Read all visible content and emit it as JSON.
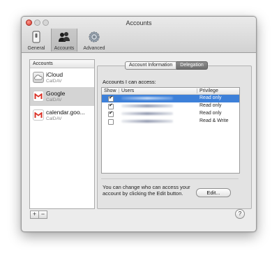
{
  "window": {
    "title": "Accounts"
  },
  "toolbar": {
    "items": [
      {
        "label": "General",
        "icon": "general-switch-icon"
      },
      {
        "label": "Accounts",
        "icon": "accounts-people-icon"
      },
      {
        "label": "Advanced",
        "icon": "advanced-gear-icon"
      }
    ],
    "selected": "Accounts"
  },
  "sidebar": {
    "header": "Accounts",
    "accounts": [
      {
        "name": "iCloud",
        "type": "CalDAV",
        "icon": "icloud-icon"
      },
      {
        "name": "Google",
        "type": "CalDAV",
        "icon": "gmail-icon",
        "selected": true
      },
      {
        "name": "calendar.goo...",
        "type": "CalDAV",
        "icon": "gmail-icon"
      }
    ],
    "add_label": "+",
    "remove_label": "−"
  },
  "tabs": {
    "account_information": "Account Information",
    "delegation": "Delegation",
    "active": "Delegation"
  },
  "delegation": {
    "accounts_label": "Accounts I can access:",
    "columns": {
      "show": "Show",
      "users": "Users",
      "privilege": "Privilege"
    },
    "rows": [
      {
        "show": true,
        "privilege": "Read only",
        "selected": true
      },
      {
        "show": true,
        "privilege": "Read only"
      },
      {
        "show": true,
        "privilege": "Read only"
      },
      {
        "show": false,
        "privilege": "Read & Write"
      }
    ],
    "help_text": "You can change who can access your account by clicking the Edit button.",
    "edit_button": "Edit..."
  },
  "help_button": "?",
  "colors": {
    "selection": "#3d80d9",
    "gmail_red": "#d93025",
    "close_red": "#d8372c"
  }
}
